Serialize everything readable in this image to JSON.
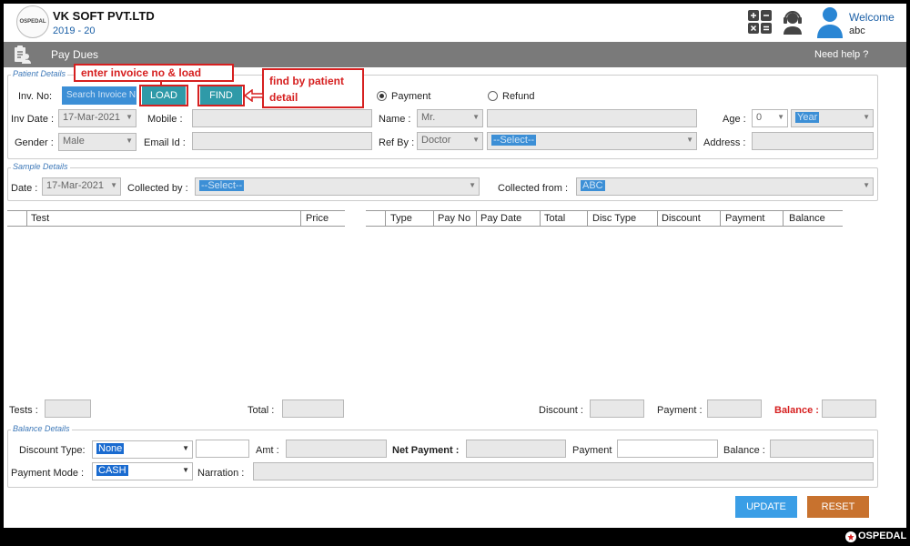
{
  "header": {
    "logo_text": "OSPEDAL",
    "company": "VK SOFT PVT.LTD",
    "year": "2019 - 20",
    "welcome": "Welcome",
    "user": "abc"
  },
  "titlebar": {
    "title": "Pay Dues",
    "help": "Need help ?"
  },
  "patient": {
    "legend": "Patient Details",
    "inv_no_label": "Inv. No:",
    "inv_no_placeholder": "Search Invoice No",
    "load_btn": "LOAD",
    "find_btn": "FIND",
    "payment_label": "Payment",
    "refund_label": "Refund",
    "inv_date_label": "Inv Date :",
    "inv_date_value": "17-Mar-2021",
    "mobile_label": "Mobile :",
    "name_label": "Name :",
    "name_prefix": "Mr.",
    "age_label": "Age :",
    "age_value": "0",
    "age_unit": "Year",
    "gender_label": "Gender :",
    "gender_value": "Male",
    "email_label": "Email Id :",
    "refby_label": "Ref By :",
    "refby_value": "Doctor",
    "refby_select": "--Select--",
    "address_label": "Address :"
  },
  "annotations": {
    "invoice_note": "enter invoice no & load",
    "find_note": "find by patient detail"
  },
  "sample": {
    "legend": "Sample Details",
    "date_label": "Date :",
    "date_value": "17-Mar-2021",
    "collected_by_label": "Collected by :",
    "collected_by_value": "--Select--",
    "collected_from_label": "Collected from :",
    "collected_from_value": "ABC"
  },
  "test_table": {
    "columns": [
      "Test",
      "Price"
    ]
  },
  "pay_table": {
    "columns": [
      "Type",
      "Pay No",
      "Pay Date",
      "Total",
      "Disc Type",
      "Discount",
      "Payment",
      "Balance"
    ]
  },
  "totals": {
    "tests_label": "Tests :",
    "total_label": "Total :",
    "discount_label": "Discount :",
    "payment_label": "Payment :",
    "balance_label": "Balance :"
  },
  "balance": {
    "legend": "Balance Details",
    "discount_type_label": "Discount Type:",
    "discount_type_value": "None",
    "amt_label": "Amt :",
    "net_payment_label": "Net Payment :",
    "payment_label": "Payment",
    "balance_label": "Balance :",
    "payment_mode_label": "Payment Mode :",
    "payment_mode_value": "CASH",
    "narration_label": "Narration :"
  },
  "actions": {
    "update": "UPDATE",
    "reset": "RESET"
  },
  "footer": {
    "brand": "OSPEDAL"
  },
  "colors": {
    "teal_button": "#2f9aa8",
    "update_button": "#3a9ee6",
    "reset_button": "#c8722e",
    "annotation_red": "#d62020",
    "balance_red": "#d62020",
    "titlebar": "#7a7a7a"
  }
}
